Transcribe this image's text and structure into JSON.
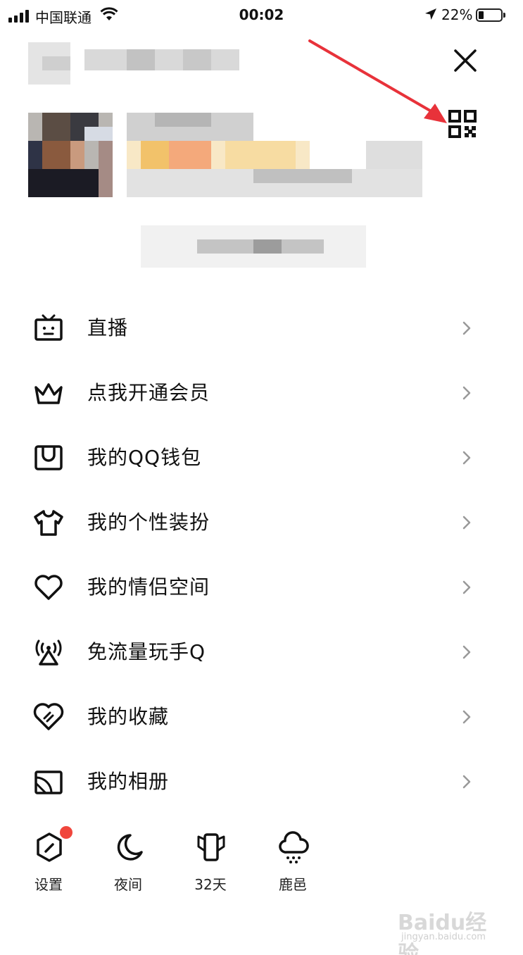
{
  "status_bar": {
    "carrier": "中国联通",
    "time": "00:02",
    "battery": "22%",
    "battery_level": 0.22
  },
  "menu": [
    {
      "label": "直播",
      "icon": "tv-icon"
    },
    {
      "label": "点我开通会员",
      "icon": "crown-icon"
    },
    {
      "label": "我的QQ钱包",
      "icon": "wallet-icon"
    },
    {
      "label": "我的个性装扮",
      "icon": "tshirt-icon"
    },
    {
      "label": "我的情侣空间",
      "icon": "heart-icon"
    },
    {
      "label": "免流量玩手Q",
      "icon": "signal-tower-icon"
    },
    {
      "label": "我的收藏",
      "icon": "favorite-heart-icon"
    },
    {
      "label": "我的相册",
      "icon": "album-icon"
    }
  ],
  "bottom_bar": [
    {
      "label": "设置",
      "icon": "settings-hexagon-icon"
    },
    {
      "label": "夜间",
      "icon": "moon-icon"
    },
    {
      "label": "32天",
      "icon": "phone-wings-icon"
    },
    {
      "label": "鹿邑",
      "icon": "rain-cloud-icon"
    }
  ],
  "watermark": {
    "line1": "Baidu经验",
    "line2": "jingyan.baidu.com"
  },
  "colors": {
    "badge": "#f0463c",
    "annotation_arrow": "#e8323a"
  }
}
